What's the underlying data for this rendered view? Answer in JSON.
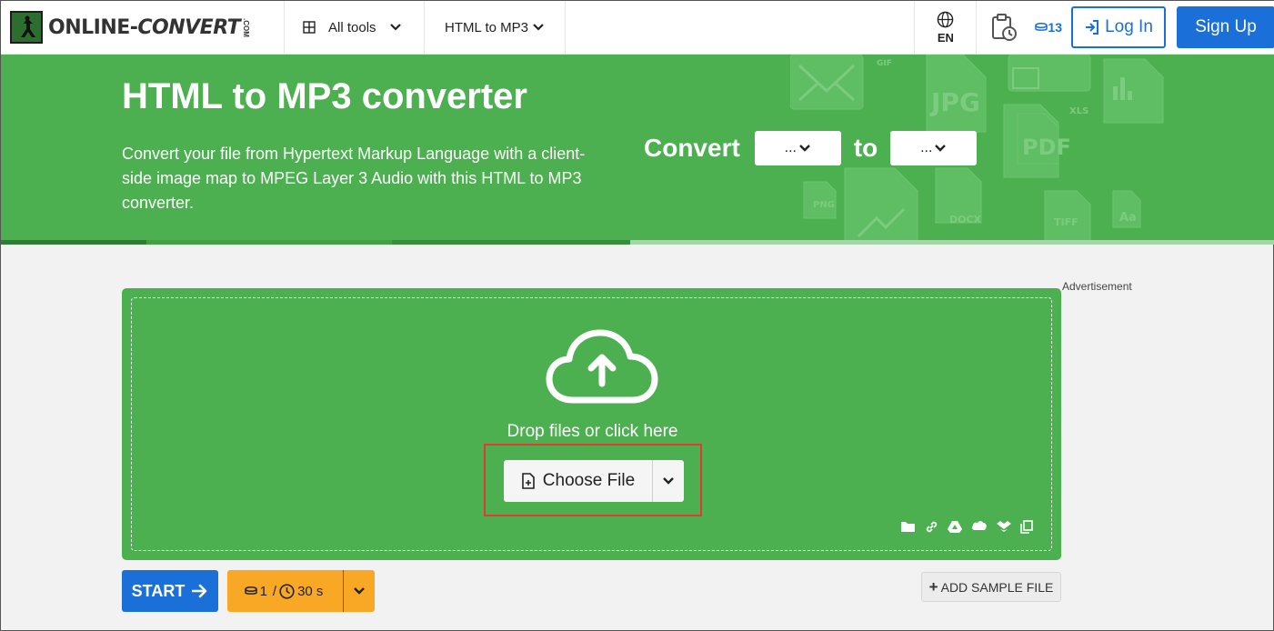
{
  "brand": {
    "name_part1": "ONLINE-",
    "name_part2": "CONVERT",
    "name_suffix": ".COM"
  },
  "nav": {
    "all_tools": "All tools",
    "converter": "HTML to MP3",
    "language": "EN",
    "credits": "13",
    "login": "Log In",
    "signup": "Sign Up"
  },
  "hero": {
    "title": "HTML to MP3 converter",
    "description": "Convert your file from Hypertext Markup Language with a client-side image map to MPEG Layer 3 Audio with this HTML to MP3 converter.",
    "convert_label": "Convert",
    "to_label": "to",
    "from_value": "...",
    "to_value": "..."
  },
  "upload": {
    "drop_text": "Drop files or click here",
    "choose_file": "Choose File"
  },
  "advertisement": "Advertisement",
  "actions": {
    "start": "START",
    "cost_credits": "1",
    "cost_separator": "/",
    "cost_time": "30 s",
    "add_sample": "ADD SAMPLE FILE"
  },
  "colors": {
    "brand_green": "#4caf50",
    "primary_blue": "#1a6fd8",
    "cost_orange": "#f9a825",
    "highlight_red": "#e53935"
  }
}
